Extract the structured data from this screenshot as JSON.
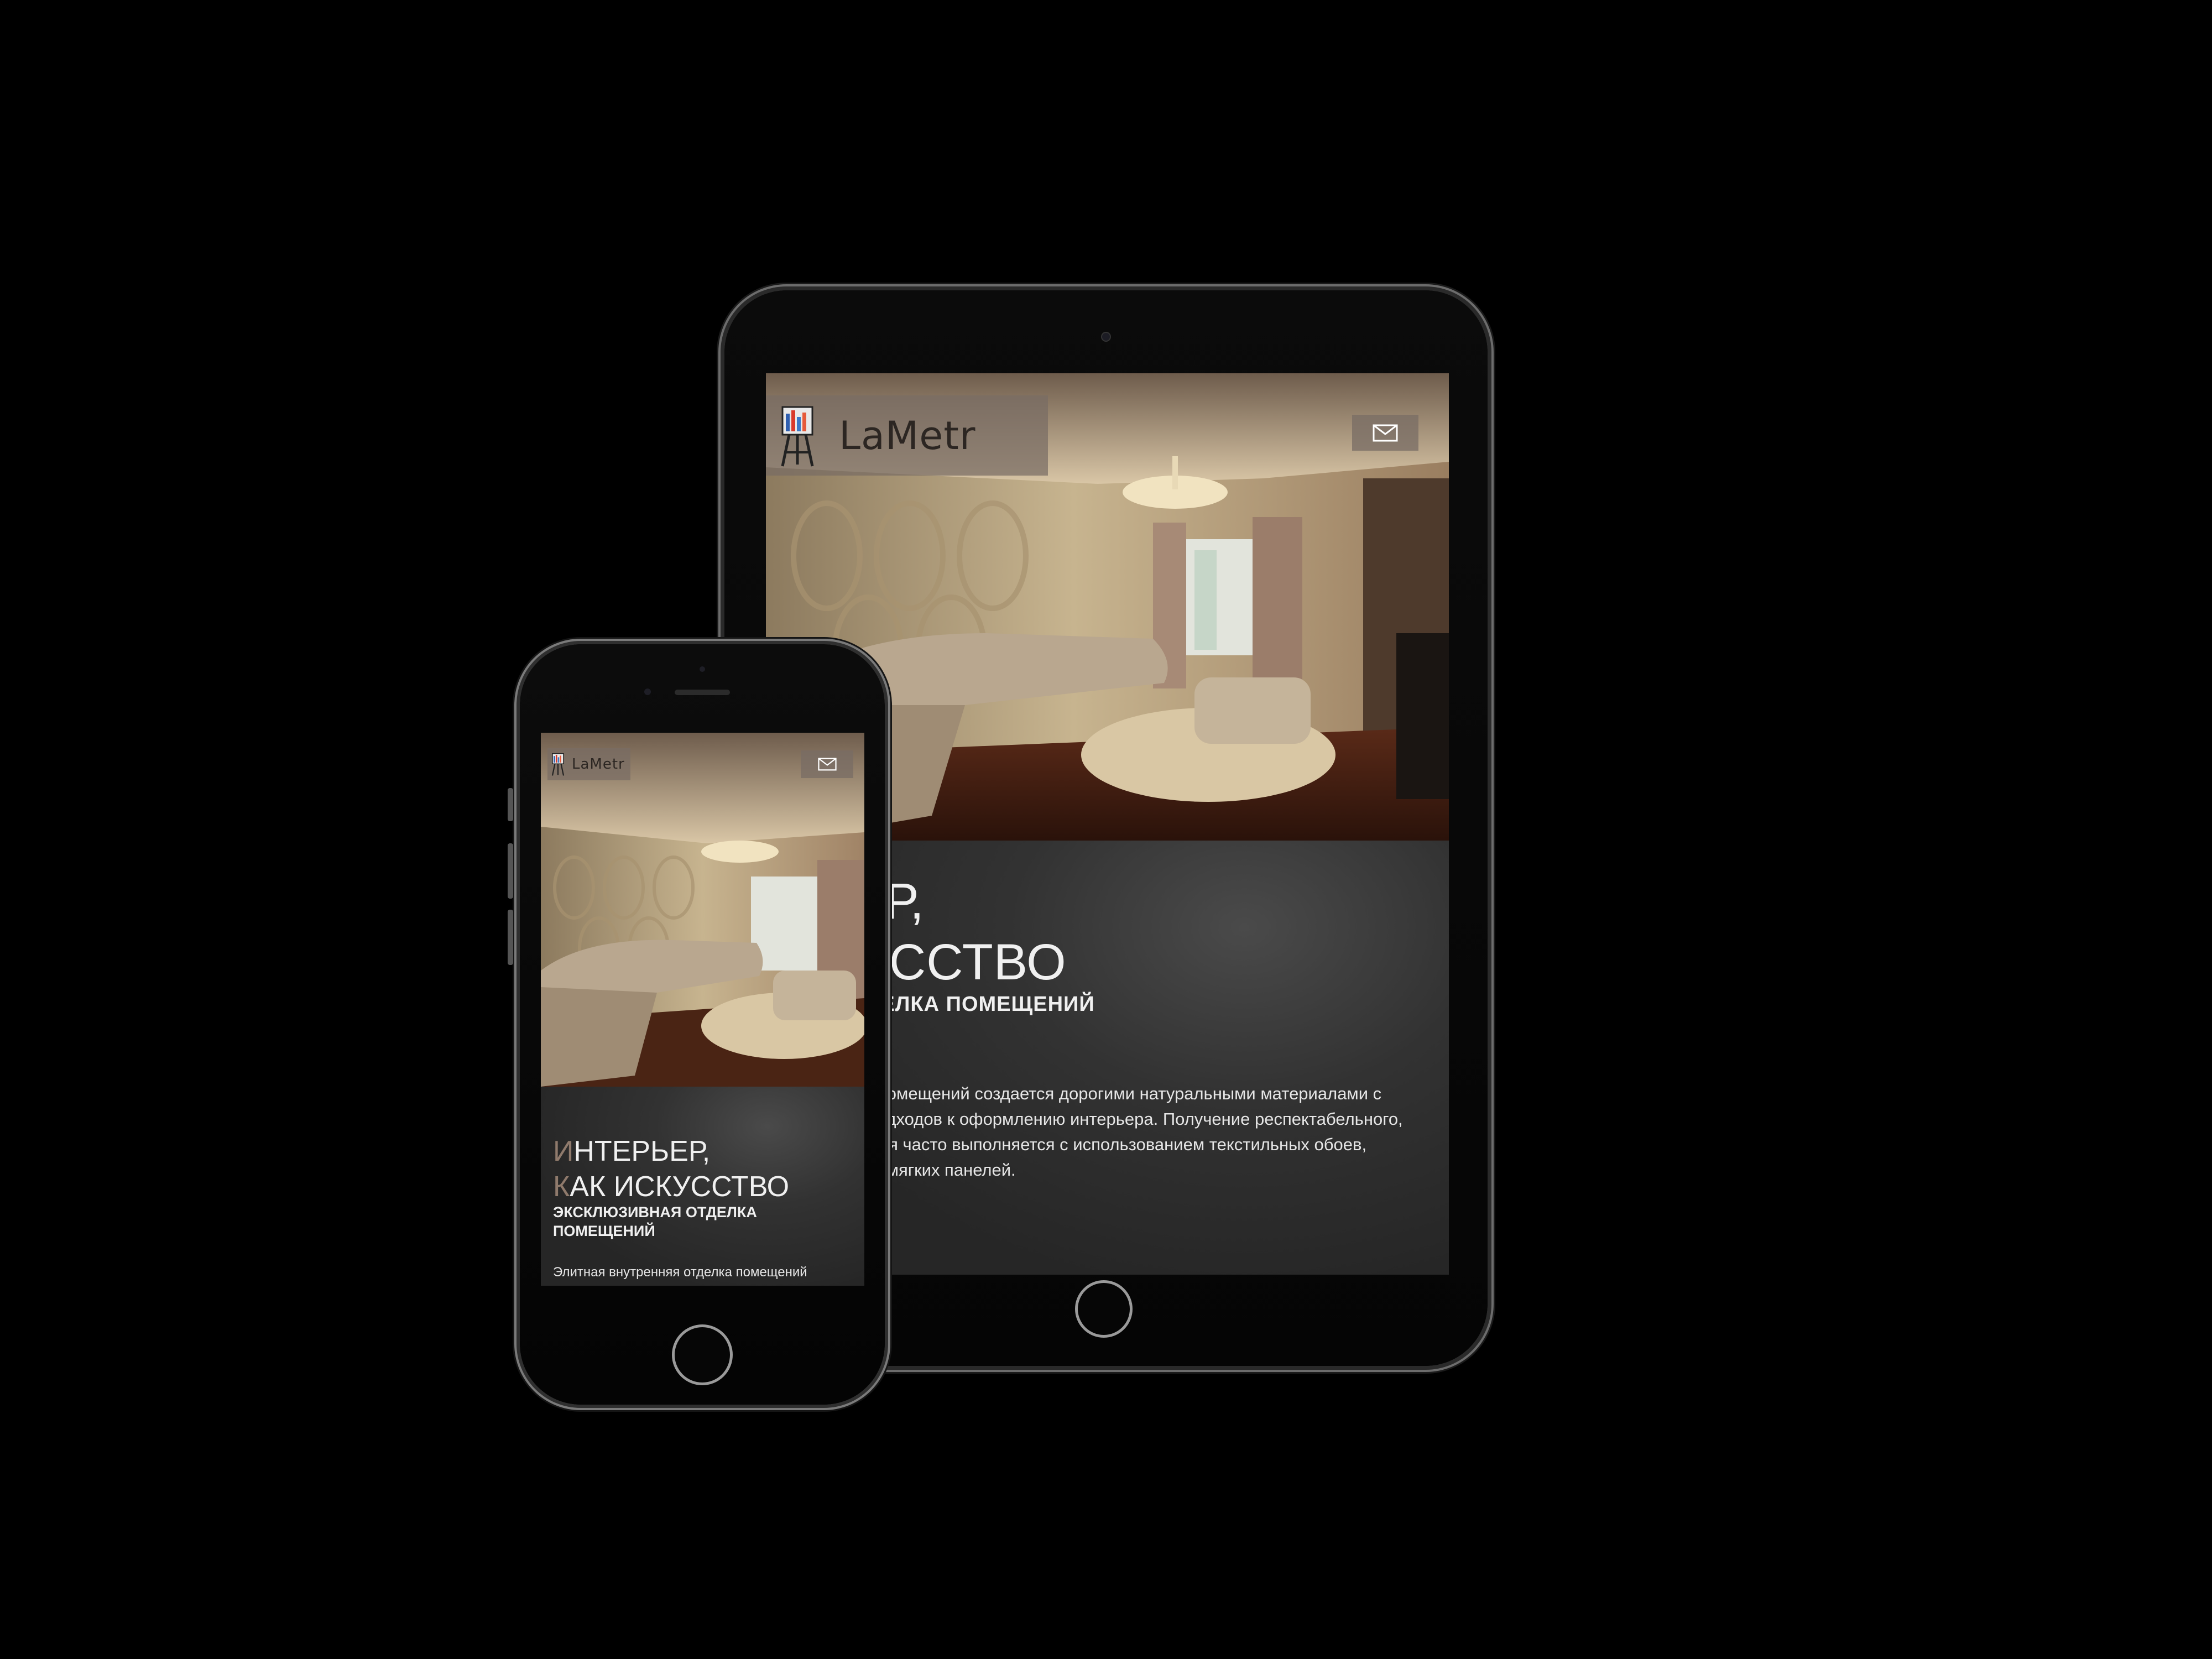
{
  "site": {
    "brand": "LaMetr",
    "hero": {
      "title_line1_first": "И",
      "title_line1_rest": "НТЕРЬЕР,",
      "title_line2_first": "К",
      "title_line2_rest": "АК ИСКУССТВО",
      "subtitle": "Эксклюзивная отделка помещений"
    },
    "tablet_intro": "Элитная внутренняя отделка помещений создается дорогими натуральными материалами с применением современных подходов к оформлению интерьера. Получение респектабельного, комфортного и стильного жилья часто выполняется с использованием текстильных обоев, шелка, оникса, мрамора, 3D и мягких панелей.",
    "phone_intro": "Элитная внутренняя отделка помещений"
  },
  "icons": {
    "logo": "easel-logo-icon",
    "mail": "envelope-icon"
  },
  "colors": {
    "background": "#000000",
    "content_bg": "#262626",
    "accent": "#8f7a6c",
    "logo_box": "#786c64",
    "text": "#f0f0f0"
  }
}
